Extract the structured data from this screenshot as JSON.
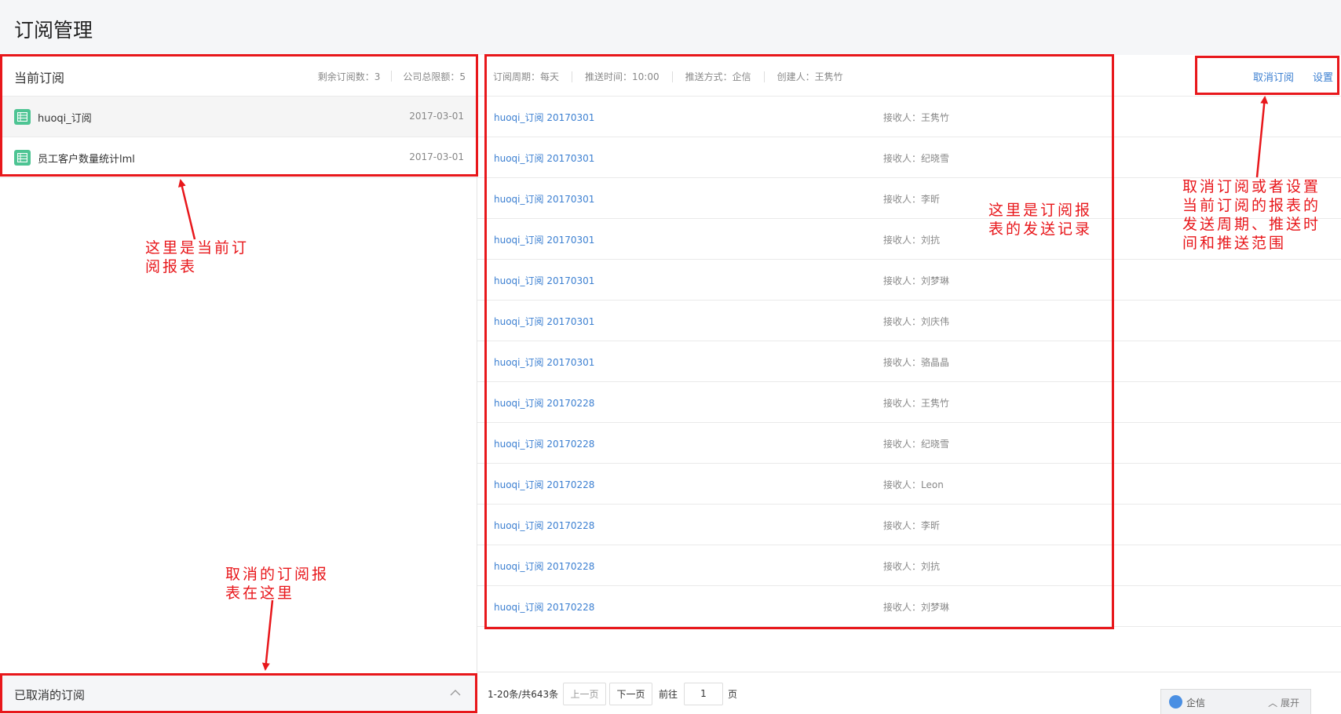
{
  "page": {
    "title": "订阅管理"
  },
  "current_subscriptions": {
    "title": "当前订阅",
    "remaining": "剩余订阅数：3",
    "company_limit": "公司总限额：5",
    "items": [
      {
        "name": "huoqi_订阅",
        "date": "2017-03-01",
        "icon": "report-icon"
      },
      {
        "name": "员工客户数量统计lml",
        "date": "2017-03-01",
        "icon": "report-icon"
      }
    ]
  },
  "cancelled_subscriptions": {
    "label": "已取消的订阅",
    "icon": "chevron-up-icon"
  },
  "subscription_meta": {
    "cycle": "订阅周期：每天",
    "push_time": "推送时间：10:00",
    "push_method": "推送方式：企信",
    "creator": "创建人：王隽竹",
    "cancel_label": "取消订阅",
    "settings_label": "设置"
  },
  "send_records": [
    {
      "name": "huoqi_订阅 20170301",
      "receiver": "接收人：王隽竹"
    },
    {
      "name": "huoqi_订阅 20170301",
      "receiver": "接收人：纪晓雪"
    },
    {
      "name": "huoqi_订阅 20170301",
      "receiver": "接收人：李昕"
    },
    {
      "name": "huoqi_订阅 20170301",
      "receiver": "接收人：刘抗"
    },
    {
      "name": "huoqi_订阅 20170301",
      "receiver": "接收人：刘梦琳"
    },
    {
      "name": "huoqi_订阅 20170301",
      "receiver": "接收人：刘庆伟"
    },
    {
      "name": "huoqi_订阅 20170301",
      "receiver": "接收人：骆晶晶"
    },
    {
      "name": "huoqi_订阅 20170228",
      "receiver": "接收人：王隽竹"
    },
    {
      "name": "huoqi_订阅 20170228",
      "receiver": "接收人：纪晓雪"
    },
    {
      "name": "huoqi_订阅 20170228",
      "receiver": "接收人：Leon"
    },
    {
      "name": "huoqi_订阅 20170228",
      "receiver": "接收人：李昕"
    },
    {
      "name": "huoqi_订阅 20170228",
      "receiver": "接收人：刘抗"
    },
    {
      "name": "huoqi_订阅 20170228",
      "receiver": "接收人：刘梦琳"
    }
  ],
  "pagination": {
    "total": "1-20条/共643条",
    "prev": "上一页",
    "next": "下一页",
    "goto": "前往",
    "page": "1",
    "unit": "页"
  },
  "chat_widget": {
    "name": "企信",
    "expand": "展开"
  },
  "annotations": {
    "current": "这里是当前订\n阅报表",
    "records": "这里是订阅报\n表的发送记录",
    "settings": "取消订阅或者设置\n当前订阅的报表的\n发送周期、推送时\n间和推送范围",
    "cancelled": "取消的订阅报\n表在这里",
    "color": "#e8171b"
  },
  "colors": {
    "link": "#3b7fd1",
    "icon_green": "#4dc493",
    "annotation": "#e8171b"
  }
}
